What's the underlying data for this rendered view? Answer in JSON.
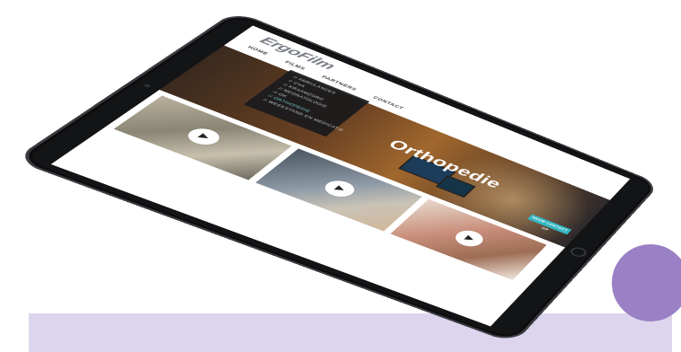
{
  "site": {
    "logo": "ErgoFilm",
    "nav": [
      "HOME",
      "FILMS",
      "PARTNERS",
      "CONTACT"
    ],
    "dropdown": [
      "// AMBULANCES",
      "// CVA",
      "// KRAAMZORG",
      "// NEONATOLOGIE",
      "// OK",
      "// ORTHOPEDIE",
      "// WEEKSTAND EN MEDICATIE"
    ],
    "dropdown_active_index": 5,
    "hero_title": "Orthopedie",
    "contact_button": "NEEM CONTACT OP",
    "tiles": [
      {
        "icon": "play-icon"
      },
      {
        "icon": "play-icon"
      },
      {
        "icon": "play-icon"
      }
    ]
  },
  "colors": {
    "accent": "#35b6c2",
    "purple_circle": "#9a80c4",
    "lavender_bar": "#ddd5ee"
  }
}
